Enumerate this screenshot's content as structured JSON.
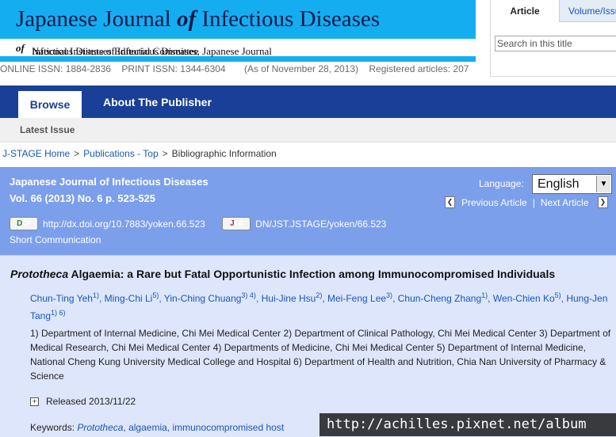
{
  "banner": {
    "title_pre": "Japanese Journal ",
    "title_of": "of",
    "title_post": " Infectious Diseases",
    "sub_pre": "National Institute of Infectious Diseases, Japanese Journal ",
    "sub_of": "of",
    "sub_post": " Infectious Diseases Editorial Committee"
  },
  "issn": {
    "online": "ONLINE ISSN: 1884-2836",
    "print": "PRINT ISSN: 1344-6304",
    "as_of": "(As of November 28, 2013)",
    "registered": "Registered articles: 207"
  },
  "side_panel": {
    "tab_article": "Article",
    "tab_volume": "Volume/Issue",
    "search_placeholder": "Search in this title"
  },
  "nav": {
    "browse": "Browse",
    "about": "About The Publisher",
    "latest_issue": "Latest Issue"
  },
  "breadcrumb": {
    "home": "J-STAGE Home",
    "publications": "Publications - Top",
    "current": "Bibliographic Information",
    "separator": ">"
  },
  "article_header": {
    "journal": "Japanese Journal of Infectious Diseases",
    "volume": "Vol. 66 (2013) No. 6 p. 523-525",
    "doi_badge_d": "D",
    "doi_badge_rest": "OI",
    "doi_link": "http://dx.doi.org/10.7883/yoken.66.523",
    "joi_badge_j": "J",
    "joi_badge_rest": "OI",
    "joi_link": "DN/JST.JSTAGE/yoken/66.523",
    "type": "Short Communication",
    "language_label": "Language:",
    "language_value": "English",
    "prev": "Previous Article",
    "next": "Next Article",
    "pn_sep": "|"
  },
  "article": {
    "title_italic": "Prototheca",
    "title_rest": " Algaemia: a Rare but Fatal Opportunistic Infection among Immunocompromised Individuals",
    "authors": [
      {
        "name": "Chun-Ting Yeh",
        "sup": "1)"
      },
      {
        "name": "Ming-Chi Li",
        "sup": "5)"
      },
      {
        "name": "Yin-Ching Chuang",
        "sup": "3) 4)"
      },
      {
        "name": "Hui-Jine Hsu",
        "sup": "2)"
      },
      {
        "name": "Mei-Feng Lee",
        "sup": "3)"
      },
      {
        "name": "Chun-Cheng Zhang",
        "sup": "1)"
      },
      {
        "name": "Wen-Chien Ko",
        "sup": "5)"
      },
      {
        "name": "Hung-Jen Tang",
        "sup": "1) 6)"
      }
    ],
    "affiliations": "1) Department of Internal Medicine, Chi Mei Medical Center 2) Department of Clinical Pathology, Chi Mei Medical Center 3) Department of Medical Research, Chi Mei Medical Center 4) Departments of Medicine, Chi Mei Medical Center 5) Department of Internal Medicine, National Cheng Kung University Medical College and Hospital 6) Department of Health and Nutrition, Chia Nan University of Pharmacy & Science",
    "released": "Released 2013/11/22",
    "keywords_label": "Keywords:",
    "keywords_italic": "Prototheca",
    "keywords_rest": ", algaemia, immunocompromised host"
  },
  "watermark": "http://achilles.pixnet.net/album",
  "icons": {
    "prev": "chevron-left-icon",
    "next": "chevron-right-icon",
    "select": "caret-down-icon",
    "expand": "plus-icon"
  }
}
